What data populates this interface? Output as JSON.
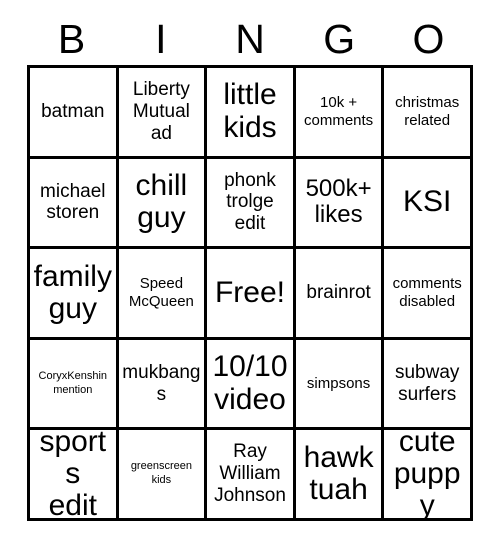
{
  "card": {
    "header_letters": [
      "B",
      "I",
      "N",
      "G",
      "O"
    ],
    "rows": [
      [
        {
          "label": "batman",
          "size": "md"
        },
        {
          "label": "Liberty\nMutual\nad",
          "size": "md"
        },
        {
          "label": "little\nkids",
          "size": "xl"
        },
        {
          "label": "10k +\ncomments",
          "size": "sm"
        },
        {
          "label": "christmas\nrelated",
          "size": "sm"
        }
      ],
      [
        {
          "label": "michael\nstoren",
          "size": "md"
        },
        {
          "label": "chill\nguy",
          "size": "xl"
        },
        {
          "label": "phonk\ntrolge\nedit",
          "size": "md"
        },
        {
          "label": "500k+\nlikes",
          "size": "lg"
        },
        {
          "label": "KSI",
          "size": "xl"
        }
      ],
      [
        {
          "label": "family\nguy",
          "size": "xl"
        },
        {
          "label": "Speed\nMcQueen",
          "size": "sm"
        },
        {
          "label": "Free!",
          "size": "xl"
        },
        {
          "label": "brainrot",
          "size": "md"
        },
        {
          "label": "comments\ndisabled",
          "size": "sm"
        }
      ],
      [
        {
          "label": "CoryxKenshin\nmention",
          "size": "xs"
        },
        {
          "label": "mukbangs",
          "size": "md"
        },
        {
          "label": "10/10\nvideo",
          "size": "xl"
        },
        {
          "label": "simpsons",
          "size": "sm"
        },
        {
          "label": "subway\nsurfers",
          "size": "md"
        }
      ],
      [
        {
          "label": "sports\nedit",
          "size": "xl"
        },
        {
          "label": "greenscreen\nkids",
          "size": "xs"
        },
        {
          "label": "Ray\nWilliam\nJohnson",
          "size": "md"
        },
        {
          "label": "hawk\ntuah",
          "size": "xl"
        },
        {
          "label": "cute\npuppy",
          "size": "xl"
        }
      ]
    ]
  },
  "colors": {
    "background": "#ffffff",
    "border": "#000000",
    "text": "#000000"
  }
}
